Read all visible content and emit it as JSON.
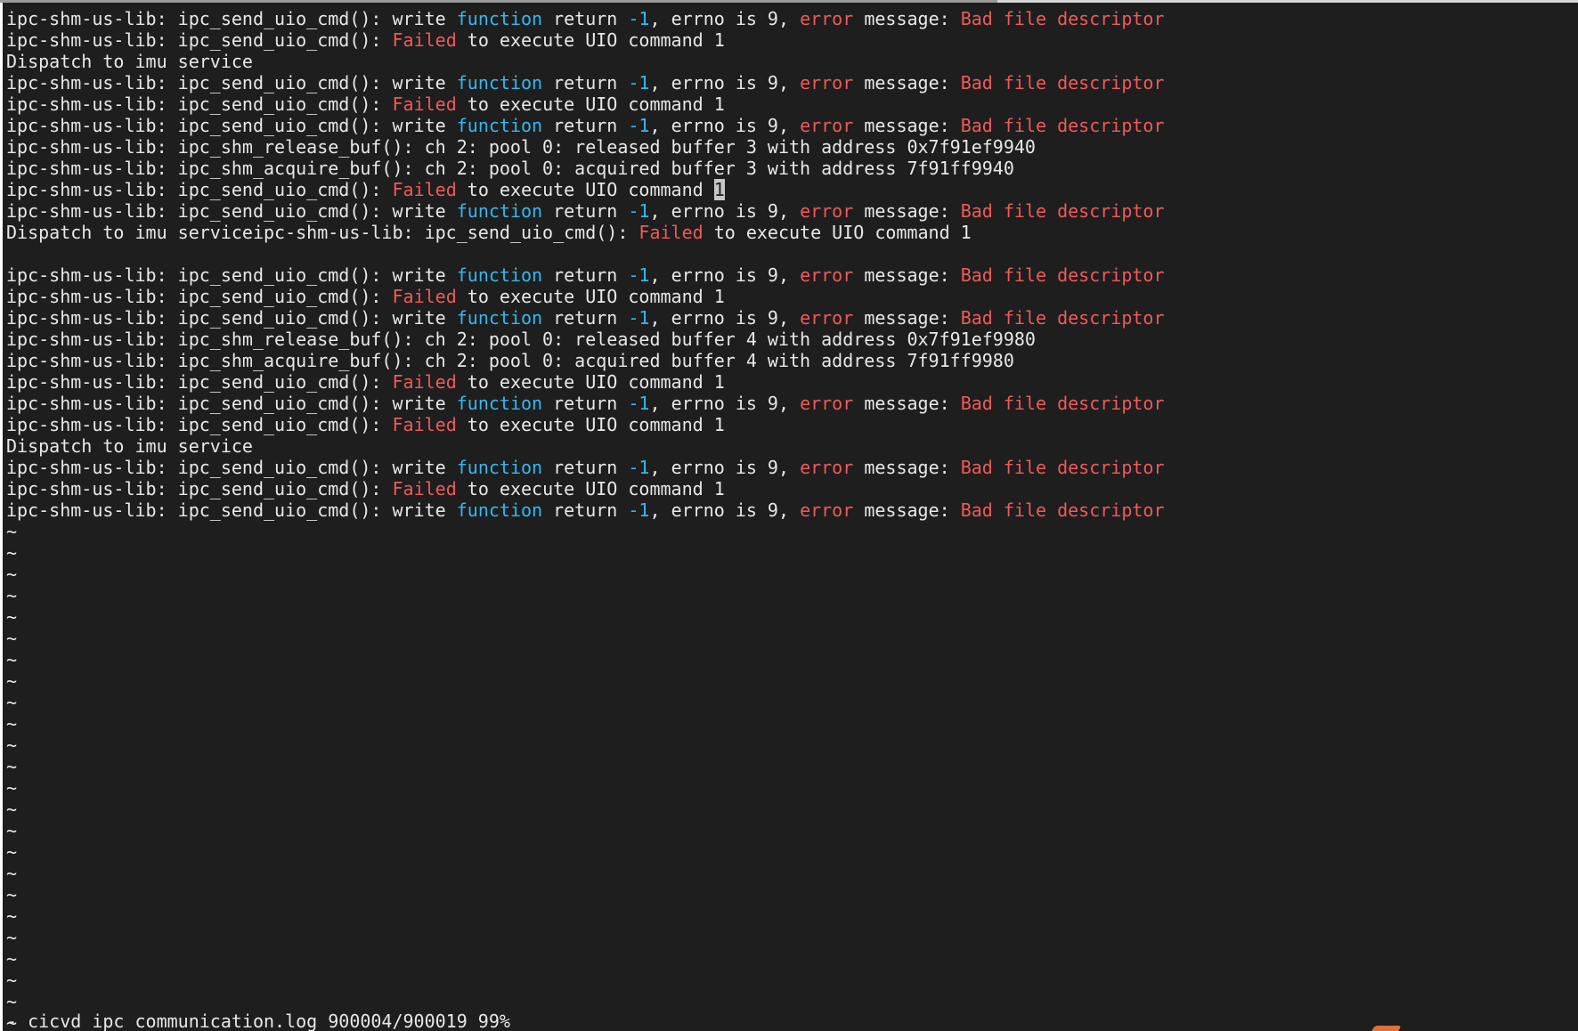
{
  "editor": {
    "lines": [
      [
        {
          "t": "ipc-shm-us-lib: ipc_send_uio_cmd(): write ",
          "c": "plain"
        },
        {
          "t": "function",
          "c": "func"
        },
        {
          "t": " return ",
          "c": "plain"
        },
        {
          "t": "-1",
          "c": "num"
        },
        {
          "t": ", errno is 9, ",
          "c": "plain"
        },
        {
          "t": "error",
          "c": "err"
        },
        {
          "t": " message: ",
          "c": "plain"
        },
        {
          "t": "Bad file descriptor",
          "c": "err"
        }
      ],
      [
        {
          "t": "ipc-shm-us-lib: ipc_send_uio_cmd(): ",
          "c": "plain"
        },
        {
          "t": "Failed",
          "c": "err"
        },
        {
          "t": " to execute UIO command 1",
          "c": "plain"
        }
      ],
      [
        {
          "t": "Dispatch to imu service",
          "c": "plain"
        }
      ],
      [
        {
          "t": "ipc-shm-us-lib: ipc_send_uio_cmd(): write ",
          "c": "plain"
        },
        {
          "t": "function",
          "c": "func"
        },
        {
          "t": " return ",
          "c": "plain"
        },
        {
          "t": "-1",
          "c": "num"
        },
        {
          "t": ", errno is 9, ",
          "c": "plain"
        },
        {
          "t": "error",
          "c": "err"
        },
        {
          "t": " message: ",
          "c": "plain"
        },
        {
          "t": "Bad file descriptor",
          "c": "err"
        }
      ],
      [
        {
          "t": "ipc-shm-us-lib: ipc_send_uio_cmd(): ",
          "c": "plain"
        },
        {
          "t": "Failed",
          "c": "err"
        },
        {
          "t": " to execute UIO command 1",
          "c": "plain"
        }
      ],
      [
        {
          "t": "ipc-shm-us-lib: ipc_send_uio_cmd(): write ",
          "c": "plain"
        },
        {
          "t": "function",
          "c": "func"
        },
        {
          "t": " return ",
          "c": "plain"
        },
        {
          "t": "-1",
          "c": "num"
        },
        {
          "t": ", errno is 9, ",
          "c": "plain"
        },
        {
          "t": "error",
          "c": "err"
        },
        {
          "t": " message: ",
          "c": "plain"
        },
        {
          "t": "Bad file descriptor",
          "c": "err"
        }
      ],
      [
        {
          "t": "ipc-shm-us-lib: ipc_shm_release_buf(): ch 2: pool 0: released buffer 3 with address 0x7f91ef9940",
          "c": "plain"
        }
      ],
      [
        {
          "t": "ipc-shm-us-lib: ipc_shm_acquire_buf(): ch 2: pool 0: acquired buffer 3 with address 7f91ff9940",
          "c": "plain"
        }
      ],
      [
        {
          "t": "ipc-shm-us-lib: ipc_send_uio_cmd(): ",
          "c": "plain"
        },
        {
          "t": "Failed",
          "c": "err"
        },
        {
          "t": " to execute UIO command ",
          "c": "plain"
        },
        {
          "t": "1",
          "c": "cursor"
        }
      ],
      [
        {
          "t": "ipc-shm-us-lib: ipc_send_uio_cmd(): write ",
          "c": "plain"
        },
        {
          "t": "function",
          "c": "func"
        },
        {
          "t": " return ",
          "c": "plain"
        },
        {
          "t": "-1",
          "c": "num"
        },
        {
          "t": ", errno is 9, ",
          "c": "plain"
        },
        {
          "t": "error",
          "c": "err"
        },
        {
          "t": " message: ",
          "c": "plain"
        },
        {
          "t": "Bad file descriptor",
          "c": "err"
        }
      ],
      [
        {
          "t": "Dispatch to imu serviceipc-shm-us-lib: ipc_send_uio_cmd(): ",
          "c": "plain"
        },
        {
          "t": "Failed",
          "c": "err"
        },
        {
          "t": " to execute UIO command 1",
          "c": "plain"
        }
      ],
      [
        {
          "t": "",
          "c": "plain"
        }
      ],
      [
        {
          "t": "ipc-shm-us-lib: ipc_send_uio_cmd(): write ",
          "c": "plain"
        },
        {
          "t": "function",
          "c": "func"
        },
        {
          "t": " return ",
          "c": "plain"
        },
        {
          "t": "-1",
          "c": "num"
        },
        {
          "t": ", errno is 9, ",
          "c": "plain"
        },
        {
          "t": "error",
          "c": "err"
        },
        {
          "t": " message: ",
          "c": "plain"
        },
        {
          "t": "Bad file descriptor",
          "c": "err"
        }
      ],
      [
        {
          "t": "ipc-shm-us-lib: ipc_send_uio_cmd(): ",
          "c": "plain"
        },
        {
          "t": "Failed",
          "c": "err"
        },
        {
          "t": " to execute UIO command 1",
          "c": "plain"
        }
      ],
      [
        {
          "t": "ipc-shm-us-lib: ipc_send_uio_cmd(): write ",
          "c": "plain"
        },
        {
          "t": "function",
          "c": "func"
        },
        {
          "t": " return ",
          "c": "plain"
        },
        {
          "t": "-1",
          "c": "num"
        },
        {
          "t": ", errno is 9, ",
          "c": "plain"
        },
        {
          "t": "error",
          "c": "err"
        },
        {
          "t": " message: ",
          "c": "plain"
        },
        {
          "t": "Bad file descriptor",
          "c": "err"
        }
      ],
      [
        {
          "t": "ipc-shm-us-lib: ipc_shm_release_buf(): ch 2: pool 0: released buffer 4 with address 0x7f91ef9980",
          "c": "plain"
        }
      ],
      [
        {
          "t": "ipc-shm-us-lib: ipc_shm_acquire_buf(): ch 2: pool 0: acquired buffer 4 with address 7f91ff9980",
          "c": "plain"
        }
      ],
      [
        {
          "t": "ipc-shm-us-lib: ipc_send_uio_cmd(): ",
          "c": "plain"
        },
        {
          "t": "Failed",
          "c": "err"
        },
        {
          "t": " to execute UIO command 1",
          "c": "plain"
        }
      ],
      [
        {
          "t": "ipc-shm-us-lib: ipc_send_uio_cmd(): write ",
          "c": "plain"
        },
        {
          "t": "function",
          "c": "func"
        },
        {
          "t": " return ",
          "c": "plain"
        },
        {
          "t": "-1",
          "c": "num"
        },
        {
          "t": ", errno is 9, ",
          "c": "plain"
        },
        {
          "t": "error",
          "c": "err"
        },
        {
          "t": " message: ",
          "c": "plain"
        },
        {
          "t": "Bad file descriptor",
          "c": "err"
        }
      ],
      [
        {
          "t": "ipc-shm-us-lib: ipc_send_uio_cmd(): ",
          "c": "plain"
        },
        {
          "t": "Failed",
          "c": "err"
        },
        {
          "t": " to execute UIO command 1",
          "c": "plain"
        }
      ],
      [
        {
          "t": "Dispatch to imu service",
          "c": "plain"
        }
      ],
      [
        {
          "t": "ipc-shm-us-lib: ipc_send_uio_cmd(): write ",
          "c": "plain"
        },
        {
          "t": "function",
          "c": "func"
        },
        {
          "t": " return ",
          "c": "plain"
        },
        {
          "t": "-1",
          "c": "num"
        },
        {
          "t": ", errno is 9, ",
          "c": "plain"
        },
        {
          "t": "error",
          "c": "err"
        },
        {
          "t": " message: ",
          "c": "plain"
        },
        {
          "t": "Bad file descriptor",
          "c": "err"
        }
      ],
      [
        {
          "t": "ipc-shm-us-lib: ipc_send_uio_cmd(): ",
          "c": "plain"
        },
        {
          "t": "Failed",
          "c": "err"
        },
        {
          "t": " to execute UIO command 1",
          "c": "plain"
        }
      ],
      [
        {
          "t": "ipc-shm-us-lib: ipc_send_uio_cmd(): write ",
          "c": "plain"
        },
        {
          "t": "function",
          "c": "func"
        },
        {
          "t": " return ",
          "c": "plain"
        },
        {
          "t": "-1",
          "c": "num"
        },
        {
          "t": ", errno is 9, ",
          "c": "plain"
        },
        {
          "t": "error",
          "c": "err"
        },
        {
          "t": " message: ",
          "c": "plain"
        },
        {
          "t": "Bad file descriptor",
          "c": "err"
        }
      ]
    ],
    "tilde_lines": [
      "~",
      "~",
      "~",
      "~",
      "~",
      "~",
      "~",
      "~",
      "~",
      "~",
      "~",
      "~",
      "~",
      "~",
      "~",
      "~",
      "~",
      "~",
      "~",
      "~",
      "~",
      "~",
      "~",
      "~",
      "~"
    ]
  },
  "status": {
    "text": "- cicvd_ipc_communication.log 900004/900019 99%"
  },
  "colors": {
    "background": "#1e1e1e",
    "text": "#e8e8e8",
    "keyword": "#35b7f0",
    "error": "#ef5a5a"
  }
}
